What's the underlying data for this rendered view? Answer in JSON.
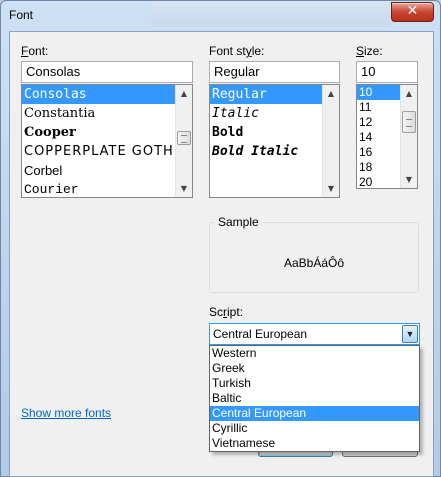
{
  "window": {
    "title": "Font",
    "close_glyph": "✕"
  },
  "font": {
    "label_prefix": "",
    "label_mnemonic": "F",
    "label_rest": "ont:",
    "value": "Consolas",
    "items": [
      {
        "label": "Consolas",
        "selected": true
      },
      {
        "label": "Constantia",
        "selected": false
      },
      {
        "label": "Cooper",
        "selected": false
      },
      {
        "label": "COPPERPLATE GOTHIC",
        "selected": false
      },
      {
        "label": "Corbel",
        "selected": false
      },
      {
        "label": "Courier",
        "selected": false
      }
    ],
    "scroll_position": 0.45
  },
  "style": {
    "label_prefix": "Font st",
    "label_mnemonic": "y",
    "label_rest": "le:",
    "value": "Regular",
    "items": [
      {
        "label": "Regular",
        "selected": true
      },
      {
        "label": "Italic",
        "selected": false
      },
      {
        "label": "Bold",
        "selected": false
      },
      {
        "label": "Bold Italic",
        "selected": false
      }
    ]
  },
  "size": {
    "label_prefix": "",
    "label_mnemonic": "S",
    "label_rest": "ize:",
    "value": "10",
    "items": [
      {
        "label": "10",
        "selected": true
      },
      {
        "label": "11",
        "selected": false
      },
      {
        "label": "12",
        "selected": false
      },
      {
        "label": "14",
        "selected": false
      },
      {
        "label": "16",
        "selected": false
      },
      {
        "label": "18",
        "selected": false
      },
      {
        "label": "20",
        "selected": false
      }
    ],
    "scroll_position": 0.2
  },
  "sample": {
    "label": "Sample",
    "text": "AaBbÁáÔô"
  },
  "script": {
    "label_prefix": "Sc",
    "label_mnemonic": "r",
    "label_rest": "ipt:",
    "value": "Central European",
    "options": [
      {
        "label": "Western",
        "selected": false
      },
      {
        "label": "Greek",
        "selected": false
      },
      {
        "label": "Turkish",
        "selected": false
      },
      {
        "label": "Baltic",
        "selected": false
      },
      {
        "label": "Central European",
        "selected": true
      },
      {
        "label": "Cyrillic",
        "selected": false
      },
      {
        "label": "Vietnamese",
        "selected": false
      }
    ]
  },
  "link": {
    "show_more_fonts": "Show more fonts"
  },
  "colors": {
    "selection": "#3399ff",
    "link": "#0066cc",
    "close": "#c7452f"
  }
}
